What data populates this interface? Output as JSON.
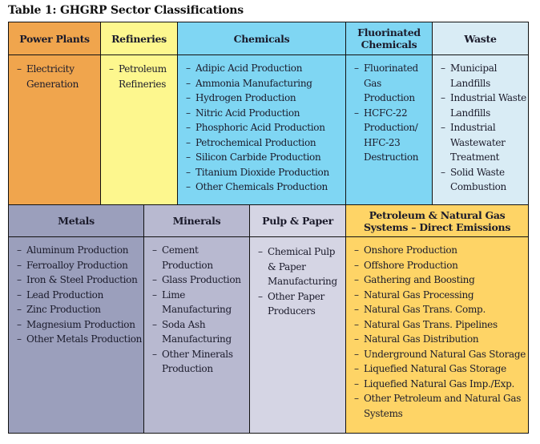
{
  "title": "Table 1: GHGRP Sector Classifications",
  "sectors": {
    "power_plants": {
      "header": "Power Plants",
      "items": [
        "Electricity Generation"
      ],
      "color": "#f0a54d"
    },
    "refineries": {
      "header": "Refineries",
      "items": [
        "Petroleum Refineries"
      ],
      "color": "#fdf78e"
    },
    "chemicals": {
      "header": "Chemicals",
      "items": [
        "Adipic Acid Production",
        "Ammonia Manufacturing",
        "Hydrogen Production",
        "Nitric Acid Production",
        "Phosphoric Acid Production",
        "Petrochemical Production",
        "Silicon Carbide Production",
        "Titanium Dioxide Production",
        "Other Chemicals Production"
      ],
      "color": "#7fd6f3"
    },
    "fluorinated_chemicals": {
      "header": "Fluorinated Chemicals",
      "items": [
        "Fluorinated Gas Production",
        "HCFC-22 Production/ HFC-23 Destruction"
      ],
      "color": "#7fd6f3"
    },
    "waste": {
      "header": "Waste",
      "items": [
        "Municipal Landfills",
        "Industrial Waste Landfills",
        "Industrial Wastewater Treatment",
        "Solid Waste Combustion"
      ],
      "color": "#d9ecf5"
    },
    "metals": {
      "header": "Metals",
      "items": [
        "Aluminum Production",
        "Ferroalloy Production",
        "Iron & Steel Production",
        "Lead Production",
        "Zinc Production",
        "Magnesium Production",
        "Other Metals Production"
      ],
      "color": "#9b9fbc"
    },
    "minerals": {
      "header": "Minerals",
      "items": [
        "Cement Production",
        "Glass Production",
        "Lime Manufacturing",
        "Soda Ash Manufacturing",
        "Other Minerals Production"
      ],
      "color": "#b8b9d0"
    },
    "pulp_paper": {
      "header": "Pulp & Paper",
      "items": [
        "Chemical Pulp & Paper Manufacturing",
        "Other Paper Producers"
      ],
      "color": "#d5d5e4"
    },
    "petroleum_natural_gas": {
      "header": "Petroleum & Natural Gas Systems – Direct Emissions",
      "items": [
        "Onshore Production",
        "Offshore Production",
        "Gathering and Boosting",
        "Natural Gas Processing",
        "Natural Gas Trans. Comp.",
        "Natural Gas Trans. Pipelines",
        "Natural Gas Distribution",
        "Underground Natural Gas Storage",
        "Liquefied Natural Gas Storage",
        "Liquefied Natural Gas Imp./Exp.",
        "Other Petroleum and Natural Gas Systems"
      ],
      "color": "#fed466"
    }
  }
}
